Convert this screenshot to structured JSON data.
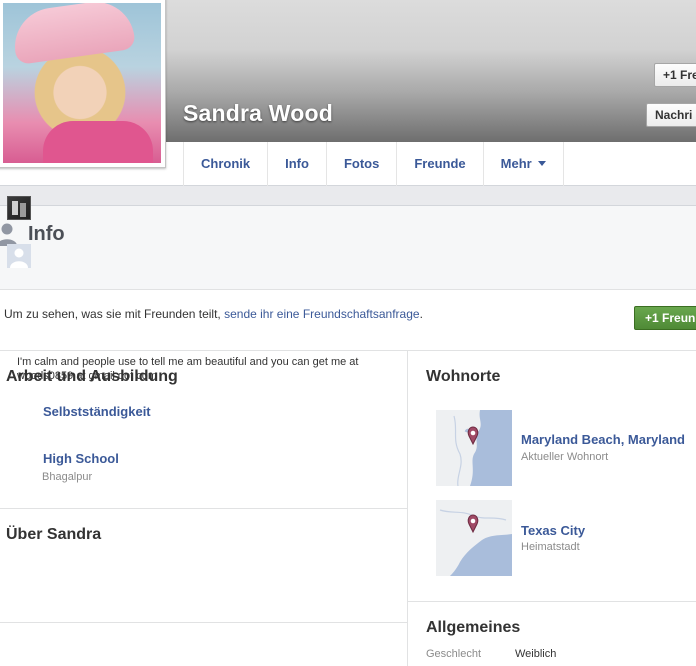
{
  "profile": {
    "name": "Sandra Wood"
  },
  "cover_buttons": {
    "friend_request_label": "+1 Fre",
    "message_label": "Nachri"
  },
  "nav": {
    "tabs": [
      "Chronik",
      "Info",
      "Fotos",
      "Freunde",
      "Mehr"
    ]
  },
  "info": {
    "title": "Info",
    "notice_prefix": "Um zu sehen, was sie mit Freunden teilt, ",
    "notice_link": "sende ihr eine Freundschaftsanfrage",
    "notice_suffix": ".",
    "add_friend_label": "+1 Freun"
  },
  "work_education": {
    "title": "Arbeit und Ausbildung",
    "items": [
      {
        "name": "Selbstständigkeit",
        "subtitle": ""
      },
      {
        "name": "High School",
        "subtitle": "Bhagalpur"
      }
    ]
  },
  "about": {
    "title": "Über Sandra",
    "text": "I'm calm and people use to tell me am beautiful and you can get me at woods0859 at gmail dot com"
  },
  "places": {
    "title": "Wohnorte",
    "items": [
      {
        "name": "Maryland Beach, Maryland",
        "subtitle": "Aktueller Wohnort"
      },
      {
        "name": "Texas City",
        "subtitle": "Heimatstadt"
      }
    ]
  },
  "general": {
    "title": "Allgemeines",
    "gender_label": "Geschlecht",
    "gender_value": "Weiblich"
  },
  "colors": {
    "link": "#3b5998",
    "green_button": "#4f8a36",
    "map_water": "#a9bddb",
    "map_land": "#eef0f2",
    "pin": "#a04a66"
  }
}
